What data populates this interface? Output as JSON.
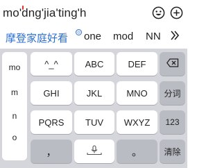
{
  "composing": {
    "text": "mo'dng'jia'ting'h",
    "emoji_icon": "smiley-face-icon",
    "add_icon": "circle-plus-icon"
  },
  "candidates": {
    "items": [
      "摩登家庭好看",
      "one",
      "mod",
      "NN"
    ],
    "more_icon": "double-chevron-right-icon",
    "accent": "#2b6fd6"
  },
  "keyboard": {
    "side_list": [
      "mo",
      "m",
      "n",
      "o"
    ],
    "keys": {
      "punct": "^_^",
      "abc": "ABC",
      "def": "DEF",
      "ghi": "GHI",
      "jkl": "JKL",
      "mno": "MNO",
      "segment": "分词",
      "pqrs": "PQRS",
      "tuv": "TUV",
      "wxyz": "WXYZ",
      "num": "123",
      "comma": "，",
      "period": "。",
      "clear": "清除"
    },
    "backspace_icon": "backspace-icon",
    "mic_icon": "microphone-icon"
  }
}
